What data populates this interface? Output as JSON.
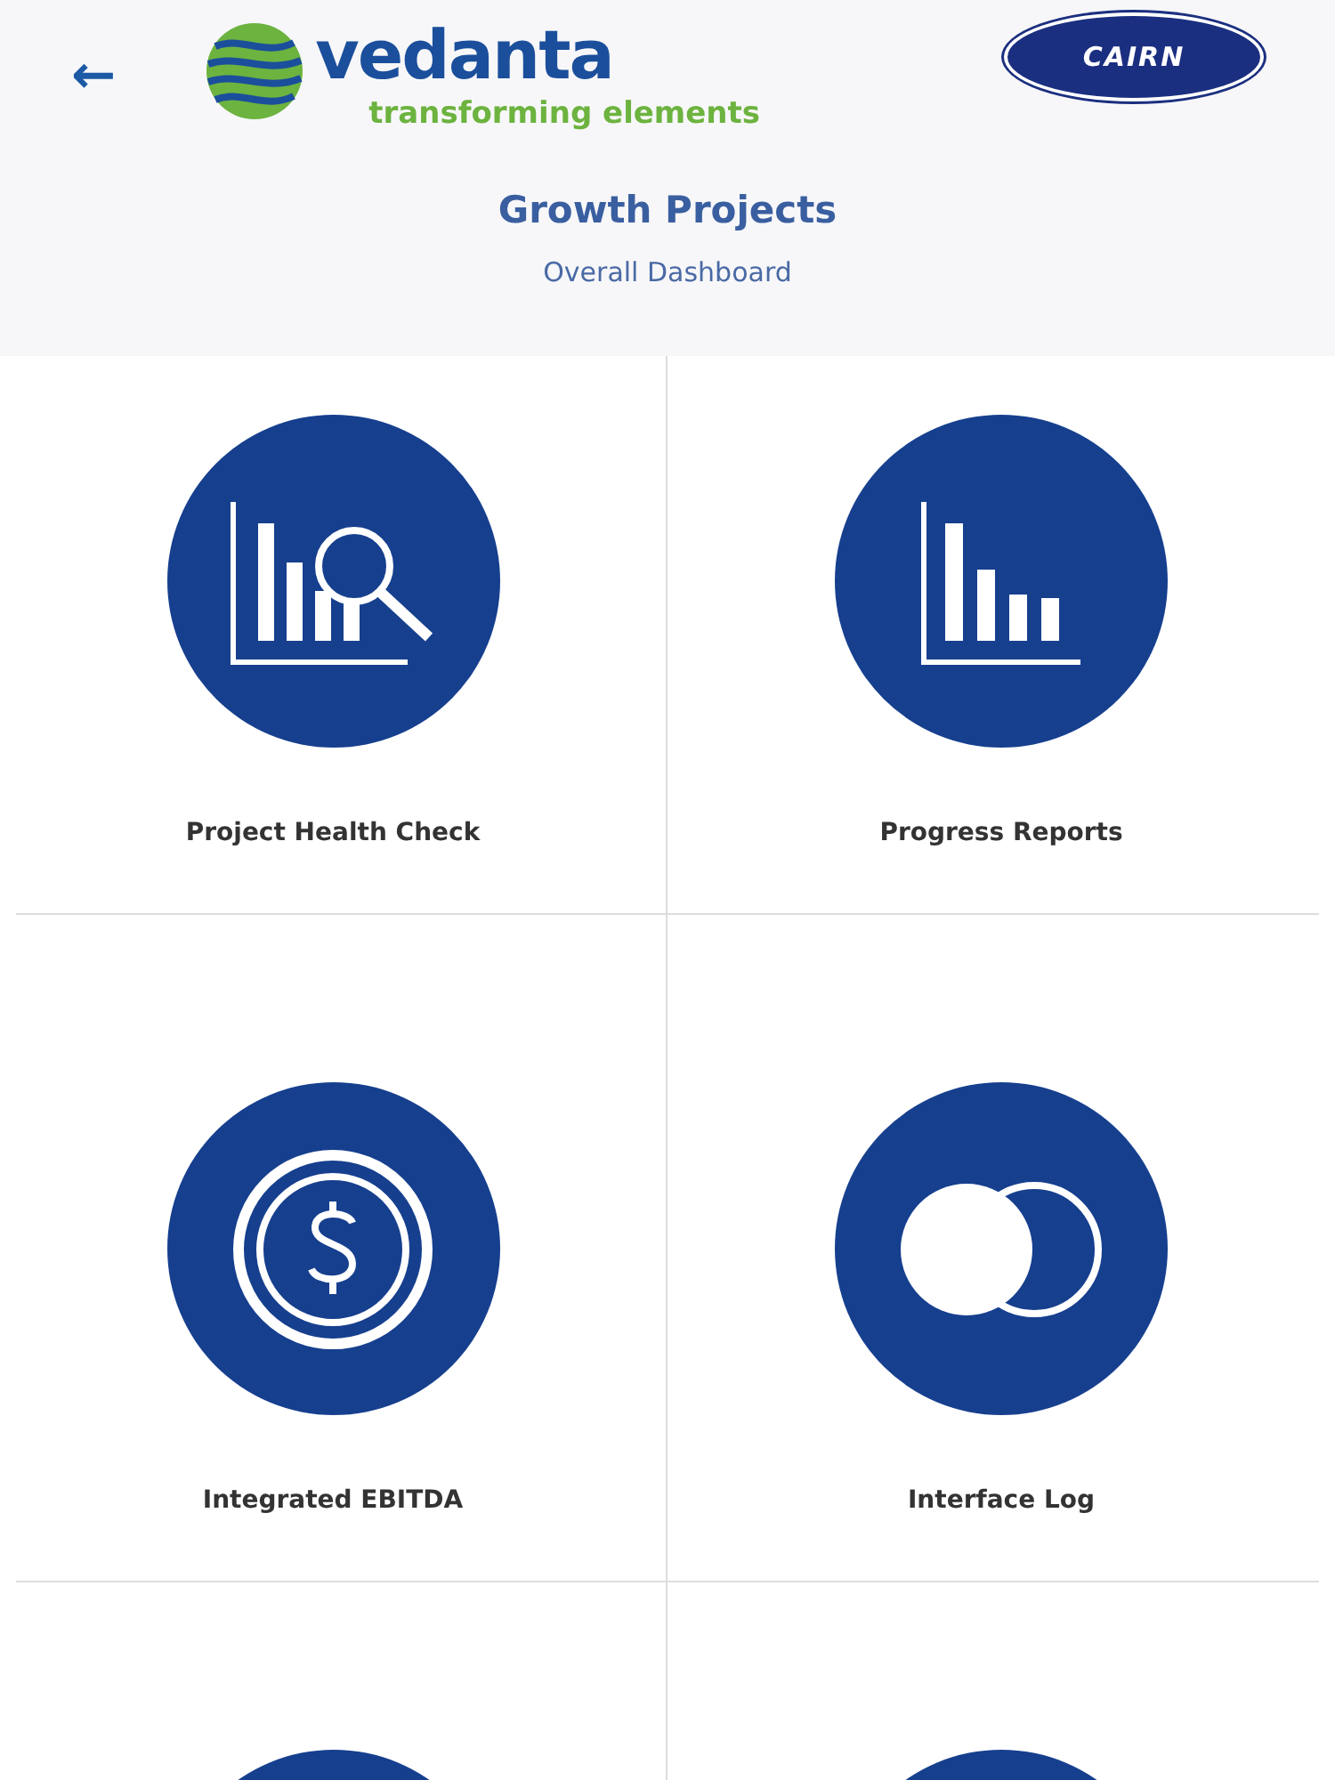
{
  "header": {
    "back": "←",
    "brand": {
      "name": "vedanta",
      "tagline": "transforming elements"
    },
    "partner": "CAIRN",
    "title": "Growth Projects",
    "subtitle": "Overall Dashboard"
  },
  "tiles": [
    {
      "kind": "search-chart",
      "label": "Project Health Check"
    },
    {
      "kind": "bar-chart",
      "label": "Progress Reports"
    },
    {
      "kind": "dollar",
      "label": "Integrated EBITDA"
    },
    {
      "kind": "circles",
      "label": "Interface Log"
    },
    {
      "kind": "blank"
    },
    {
      "kind": "blank"
    }
  ]
}
